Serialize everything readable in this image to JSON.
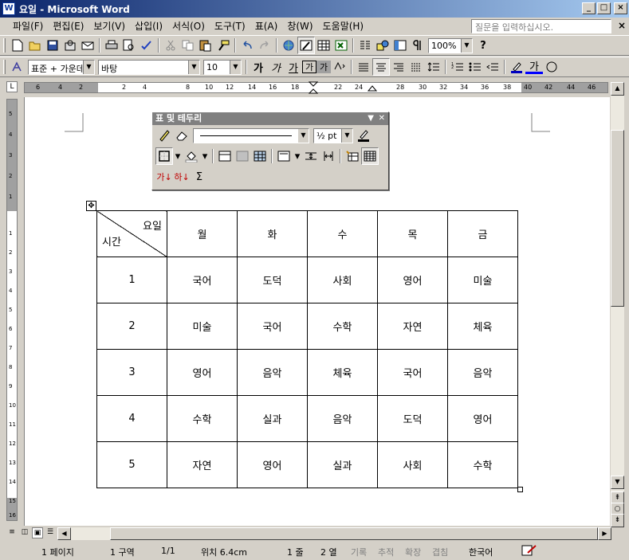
{
  "window": {
    "app_icon": "W",
    "title": "요일 - Microsoft Word",
    "min_label": "_",
    "max_label": "□",
    "close_label": "×"
  },
  "menu": {
    "items": [
      "파일(F)",
      "편집(E)",
      "보기(V)",
      "삽입(I)",
      "서식(O)",
      "도구(T)",
      "표(A)",
      "창(W)",
      "도움말(H)"
    ],
    "help_placeholder": "질문을 입력하십시오.",
    "doc_close": "×"
  },
  "toolbar_standard": {
    "icons": [
      "new-document-icon",
      "open-icon",
      "save-icon",
      "permission-icon",
      "email-icon",
      "print-icon",
      "print-preview-icon",
      "spelling-icon",
      "cut-icon",
      "copy-icon",
      "paste-icon",
      "format-painter-icon",
      "undo-icon",
      "redo-icon",
      "hyperlink-icon",
      "tables-borders-icon",
      "insert-table-icon",
      "insert-excel-icon",
      "columns-icon",
      "drawing-icon",
      "document-map-icon",
      "show-hide-icon"
    ],
    "zoom": "100%",
    "help_icon": "?"
  },
  "toolbar_format": {
    "style": "표준 + 가운데",
    "font": "바탕",
    "size": "10",
    "bold": "가",
    "italic": "가",
    "underline": "가",
    "border_char": "가",
    "shade_char": "가",
    "font_color_char": "가"
  },
  "ruler": {
    "ticks": [
      "6",
      "4",
      "2",
      "2",
      "4",
      "8",
      "10",
      "12",
      "14",
      "16",
      "18",
      "22",
      "24",
      "28",
      "30",
      "32",
      "34",
      "36",
      "38",
      "40",
      "42",
      "44",
      "46"
    ],
    "vticks": [
      "5",
      "4",
      "3",
      "2",
      "1",
      "1",
      "2",
      "3",
      "4",
      "5",
      "6",
      "7",
      "8",
      "9",
      "10",
      "11",
      "12",
      "13",
      "14",
      "15",
      "16"
    ]
  },
  "floating_toolbar": {
    "title": "표 및 테두리",
    "line_weight": "½ pt",
    "sort_asc": "가",
    "sort_desc": "하",
    "autosum": "Σ"
  },
  "table": {
    "header_top": "요일",
    "header_bottom": "시간",
    "days": [
      "월",
      "화",
      "수",
      "목",
      "금"
    ],
    "rows": [
      {
        "period": "1",
        "subjects": [
          "국어",
          "도덕",
          "사회",
          "영어",
          "미술"
        ]
      },
      {
        "period": "2",
        "subjects": [
          "미술",
          "국어",
          "수학",
          "자연",
          "체육"
        ]
      },
      {
        "period": "3",
        "subjects": [
          "영어",
          "음악",
          "체육",
          "국어",
          "음악"
        ]
      },
      {
        "period": "4",
        "subjects": [
          "수학",
          "실과",
          "음악",
          "도덕",
          "영어"
        ]
      },
      {
        "period": "5",
        "subjects": [
          "자연",
          "영어",
          "실과",
          "사회",
          "수학"
        ]
      }
    ]
  },
  "status": {
    "page": "1 페이지",
    "section": "1 구역",
    "page_count": "1/1",
    "position": "위치 6.4cm",
    "line": "1 줄",
    "column": "2 열",
    "rec": "기록",
    "trk": "추적",
    "ext": "확장",
    "ovr": "겹침",
    "language": "한국어"
  }
}
